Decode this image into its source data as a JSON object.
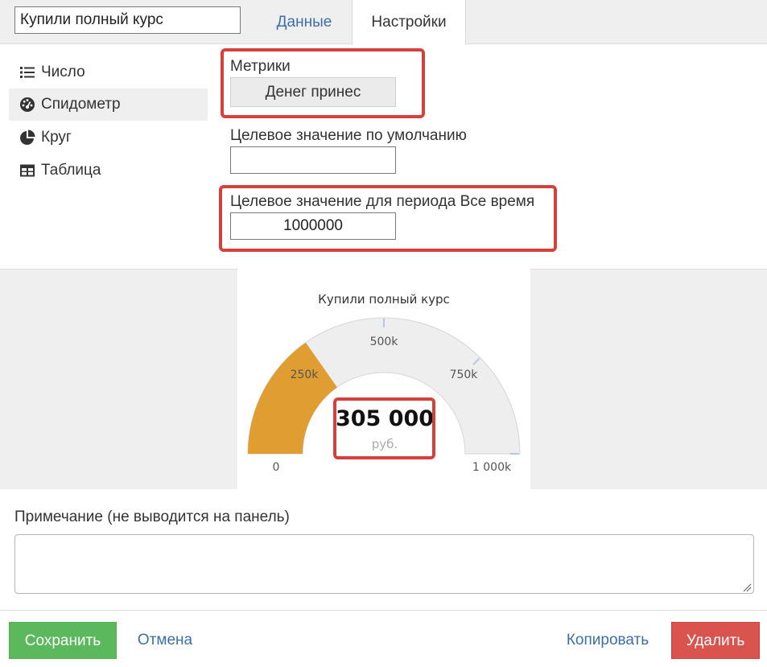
{
  "header": {
    "title_value": "Купили полный курс",
    "tabs": [
      {
        "label": "Данные",
        "active": false
      },
      {
        "label": "Настройки",
        "active": true
      }
    ]
  },
  "widget_types": [
    {
      "label": "Число",
      "icon": "list-icon",
      "active": false
    },
    {
      "label": "Спидометр",
      "icon": "speedometer-icon",
      "active": true
    },
    {
      "label": "Круг",
      "icon": "pie-chart-icon",
      "active": false
    },
    {
      "label": "Таблица",
      "icon": "table-icon",
      "active": false
    }
  ],
  "settings": {
    "metrics_label": "Метрики",
    "metric_value": "Денег принес",
    "default_target_label": "Целевое значение по умолчанию",
    "default_target_value": "",
    "period_target_label": "Целевое значение для периода Все время",
    "period_target_value": "1000000"
  },
  "gauge": {
    "title": "Купили полный курс",
    "value": 305000,
    "value_text": "305 000",
    "unit": "руб.",
    "min": 0,
    "max": 1000000,
    "min_label": "0",
    "max_label": "1 000k",
    "tick_labels": [
      {
        "value": 250000,
        "label": "250k"
      },
      {
        "value": 500000,
        "label": "500k"
      },
      {
        "value": 750000,
        "label": "750k"
      }
    ],
    "fill_color": "#df9d32",
    "track_color": "#eeeeee",
    "tick_color": "#b7c6e2"
  },
  "note": {
    "label": "Примечание (не выводится на панель)",
    "value": ""
  },
  "footer": {
    "save_label": "Сохранить",
    "cancel_label": "Отмена",
    "copy_label": "Копировать",
    "delete_label": "Удалить"
  },
  "colors": {
    "highlight": "#d4403a",
    "link": "#3d6fa6",
    "save": "#5cb85c",
    "delete": "#d9534f"
  }
}
